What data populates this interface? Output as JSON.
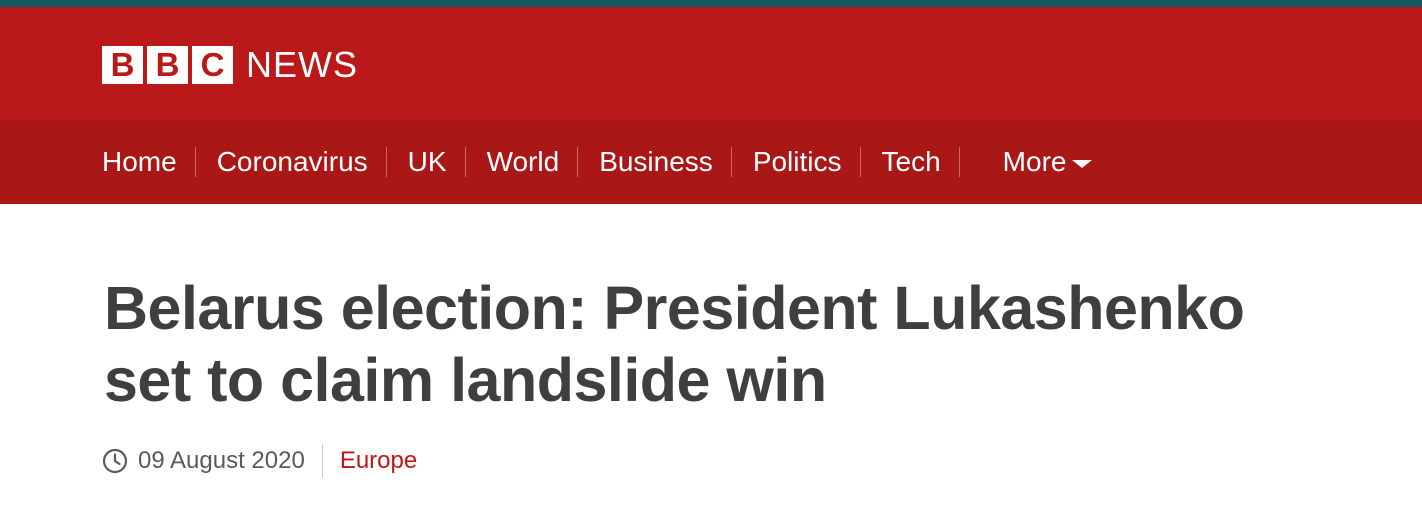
{
  "brand": {
    "logo_letters": [
      "B",
      "B",
      "C"
    ],
    "logo_word": "NEWS",
    "colors": {
      "primary": "#bb1919",
      "nav_bg": "#a91717",
      "top_strip": "#17575f",
      "headline_text": "#3f3f42"
    }
  },
  "nav": {
    "items": [
      {
        "label": "Home"
      },
      {
        "label": "Coronavirus"
      },
      {
        "label": "UK"
      },
      {
        "label": "World"
      },
      {
        "label": "Business"
      },
      {
        "label": "Politics"
      },
      {
        "label": "Tech"
      }
    ],
    "more_label": "More",
    "more_icon": "chevron-down-icon"
  },
  "article": {
    "headline": "Belarus election: President Lukashenko set to claim landslide win",
    "date": "09 August 2020",
    "date_icon": "clock-icon",
    "section": "Europe"
  }
}
